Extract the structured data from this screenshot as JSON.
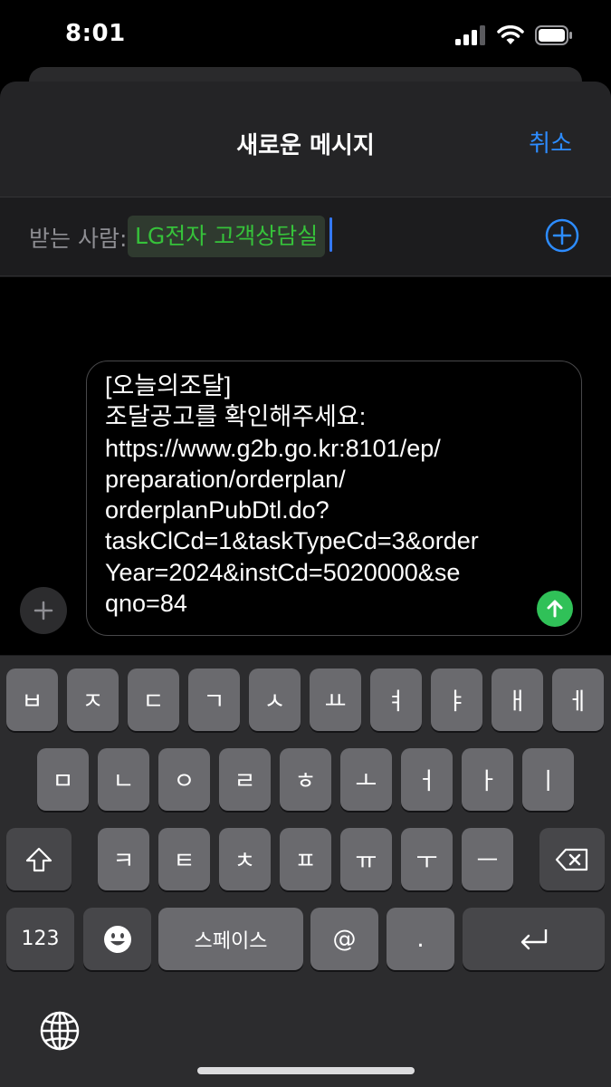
{
  "status_bar": {
    "time": "8:01"
  },
  "header": {
    "title": "새로운 메시지",
    "cancel_label": "취소"
  },
  "to_row": {
    "label": "받는 사람:",
    "recipient": "LG전자 고객상담실"
  },
  "compose": {
    "text": "[오늘의조달]\n조달공고를 확인해주세요:\nhttps://www.g2b.go.kr:8101/ep/\npreparation/orderplan/\norderplanPubDtl.do?\ntaskClCd=1&taskTypeCd=3&order\nYear=2024&instCd=5020000&se\nqno=84"
  },
  "keyboard": {
    "row1": [
      "ㅂ",
      "ㅈ",
      "ㄷ",
      "ㄱ",
      "ㅅ",
      "ㅛ",
      "ㅕ",
      "ㅑ",
      "ㅐ",
      "ㅔ"
    ],
    "row2": [
      "ㅁ",
      "ㄴ",
      "ㅇ",
      "ㄹ",
      "ㅎ",
      "ㅗ",
      "ㅓ",
      "ㅏ",
      "ㅣ"
    ],
    "row3": [
      "ㅋ",
      "ㅌ",
      "ㅊ",
      "ㅍ",
      "ㅠ",
      "ㅜ",
      "ㅡ"
    ],
    "numbers_label": "123",
    "space_label": "스페이스",
    "at_label": "@",
    "dot_label": "."
  },
  "colors": {
    "accent": "#2d8cff",
    "recipient": "#36c23a",
    "send": "#30c158"
  },
  "icons": [
    "signal-icon",
    "wifi-icon",
    "battery-icon",
    "add-circle-icon",
    "plus-icon",
    "send-arrow-icon",
    "shift-icon",
    "backspace-icon",
    "emoji-icon",
    "return-icon",
    "globe-icon"
  ]
}
